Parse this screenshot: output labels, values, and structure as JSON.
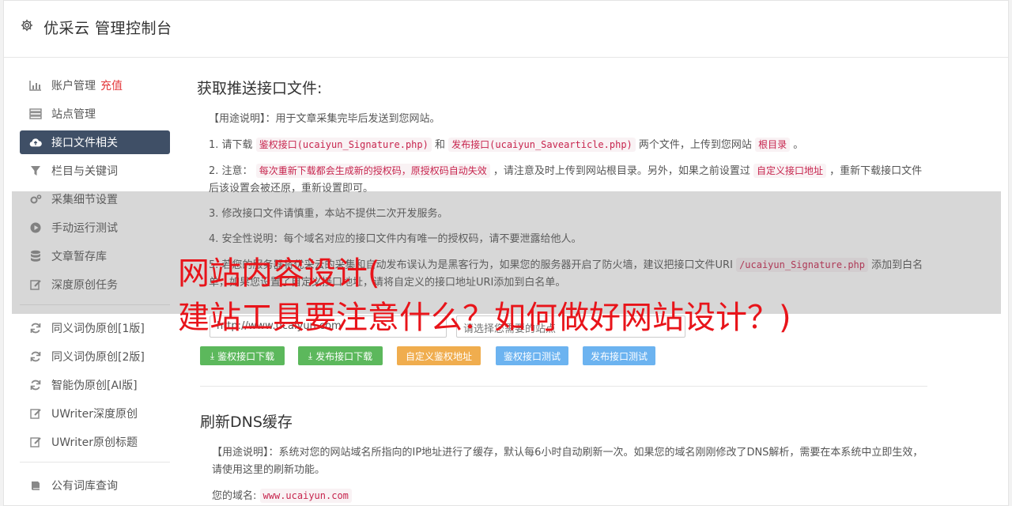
{
  "header": {
    "title": "优采云 管理控制台",
    "icon": "gear-icon"
  },
  "sidebar": {
    "group1": [
      {
        "label": "账户管理",
        "badge": "充值",
        "icon": "bar-chart-icon"
      },
      {
        "label": "站点管理",
        "icon": "server-icon"
      },
      {
        "label": "接口文件相关",
        "icon": "cloud-upload-icon",
        "active": true
      },
      {
        "label": "栏目与关键词",
        "icon": "filter-icon"
      },
      {
        "label": "采集细节设置",
        "icon": "cogs-icon"
      },
      {
        "label": "手动运行测试",
        "icon": "play-icon"
      },
      {
        "label": "文章暂存库",
        "icon": "database-icon"
      },
      {
        "label": "深度原创任务",
        "icon": "edit-icon"
      }
    ],
    "group2": [
      {
        "label": "同义词伪原创[1版]",
        "icon": "refresh-icon"
      },
      {
        "label": "同义词伪原创[2版]",
        "icon": "refresh-icon"
      },
      {
        "label": "智能伪原创[AI版]",
        "icon": "refresh-icon"
      },
      {
        "label": "UWriter深度原创",
        "icon": "edit-icon"
      },
      {
        "label": "UWriter原创标题",
        "icon": "edit-icon"
      }
    ],
    "group3": [
      {
        "label": "公有词库查询",
        "icon": "book-icon"
      }
    ]
  },
  "main": {
    "section1": {
      "title": "获取推送接口文件:",
      "usage": "【用途说明】：用于文章采集完毕后发送到您网站。",
      "step1": {
        "pre": "1. 请下载",
        "code1": "鉴权接口(ucaiyun_Signature.php)",
        "mid": "和",
        "code2": "发布接口(ucaiyun_Savearticle.php)",
        "post": "两个文件，上传到您网站",
        "code3": "根目录",
        "end": "。"
      },
      "step2": {
        "pre": "2. 注意：",
        "code1": "每次重新下载都会生成新的授权码，原授权码自动失效",
        "mid": "，请注意及时上传到网站根目录。另外，如果之前设置过",
        "code2": "自定义接口地址",
        "post": "，重新下载接口文件后该设置会被还原，重新设置即可。"
      },
      "step3": "3. 修改接口文件请慎重，本站不提供二次开发服务。",
      "step4": "4. 安全性说明：每个域名对应的接口文件内有唯一的授权码，请不要泄露给他人。",
      "step5": {
        "pre": "5. 若您的服务器将优采云的采集和自动发布误认为是黑客行为，如果您的服务器开启了防火墙，建议把接口文件URI",
        "code1": "/ucaiyun_Signature.php",
        "post": "添加到白名单，如果您设置了自定义接口地址，请将自定义的接口地址URI添加到白名单。"
      },
      "url_value": "http://www.ucaiyun.com",
      "select_placeholder": "请选择您需要的站点",
      "buttons": {
        "download_auth": "鉴权接口下载",
        "download_publish": "发布接口下载",
        "custom_auth": "自定义鉴权地址",
        "test_auth": "鉴权接口测试",
        "test_publish": "发布接口测试"
      }
    },
    "section2": {
      "title": "刷新DNS缓存",
      "usage": "【用途说明】：系统对您的网站域名所指向的IP地址进行了缓存，默认每6小时自动刷新一次。如果您的域名刚刚修改了DNS解析，需要在本系统中立即生效，请使用这里的刷新功能。",
      "domain_label": "您的域名:",
      "domain_value": "www.ucaiyun.com"
    }
  },
  "overlay": {
    "line1": "网站内容设计(",
    "line2": "建站工具要注意什么？如何做好网站设计？)"
  },
  "colors": {
    "active_nav": "#3f4f66",
    "green": "#5cb85c",
    "orange": "#f0ad4e",
    "blue": "#6cb3f0",
    "overlay_text": "#e8141a",
    "code": "#c7254e"
  }
}
